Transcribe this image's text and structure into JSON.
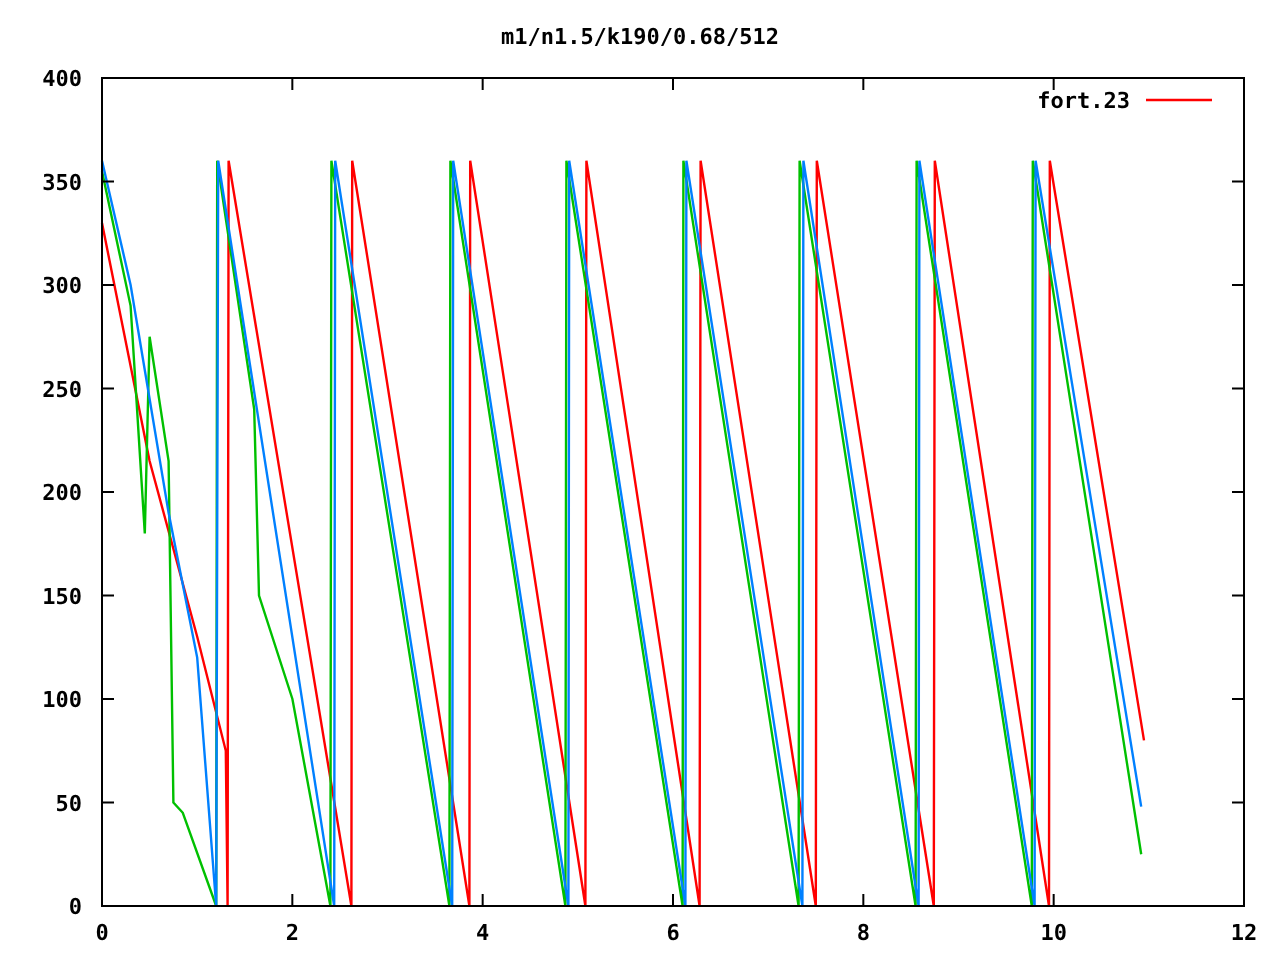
{
  "plot": {
    "chart_data": {
      "type": "line",
      "title": "m1/n1.5/k190/0.68/512",
      "xlim": [
        0,
        12
      ],
      "ylim": [
        0,
        400
      ],
      "xticks": [
        0,
        2,
        4,
        6,
        8,
        10,
        12
      ],
      "yticks": [
        0,
        50,
        100,
        150,
        200,
        250,
        300,
        350,
        400
      ],
      "series": [
        {
          "name": "fort.23",
          "color": "#ff0000",
          "x": [
            0,
            0.5,
            1.0,
            1.3,
            1.32,
            1.33,
            2.62,
            2.63,
            3.86,
            3.87,
            5.08,
            5.09,
            6.28,
            6.29,
            7.5,
            7.51,
            8.74,
            8.75,
            9.95,
            9.96,
            10.95
          ],
          "values": [
            330,
            215,
            130,
            75,
            0,
            360,
            0,
            360,
            0,
            360,
            0,
            360,
            0,
            360,
            0,
            360,
            0,
            360,
            0,
            360,
            80
          ]
        },
        {
          "color": "#00c000",
          "x": [
            0,
            0.3,
            0.45,
            0.5,
            0.7,
            0.75,
            0.85,
            1.2,
            1.21,
            1.6,
            1.65,
            2.0,
            2.4,
            2.41,
            3.65,
            3.66,
            4.87,
            4.88,
            6.1,
            6.11,
            7.32,
            7.33,
            8.55,
            8.56,
            9.77,
            9.78,
            10.92
          ],
          "values": [
            355,
            290,
            180,
            275,
            215,
            50,
            45,
            0,
            360,
            240,
            150,
            100,
            0,
            360,
            0,
            360,
            0,
            360,
            0,
            360,
            0,
            360,
            0,
            360,
            0,
            360,
            25
          ]
        },
        {
          "color": "#0080ff",
          "x": [
            0,
            0.3,
            0.7,
            1.0,
            1.2,
            1.22,
            2.44,
            2.45,
            3.68,
            3.69,
            4.9,
            4.91,
            6.13,
            6.14,
            7.36,
            7.37,
            8.58,
            8.59,
            9.8,
            9.81,
            10.92
          ],
          "values": [
            360,
            300,
            190,
            120,
            0,
            360,
            0,
            360,
            0,
            360,
            0,
            360,
            0,
            360,
            0,
            360,
            0,
            360,
            0,
            360,
            48
          ]
        }
      ]
    }
  }
}
